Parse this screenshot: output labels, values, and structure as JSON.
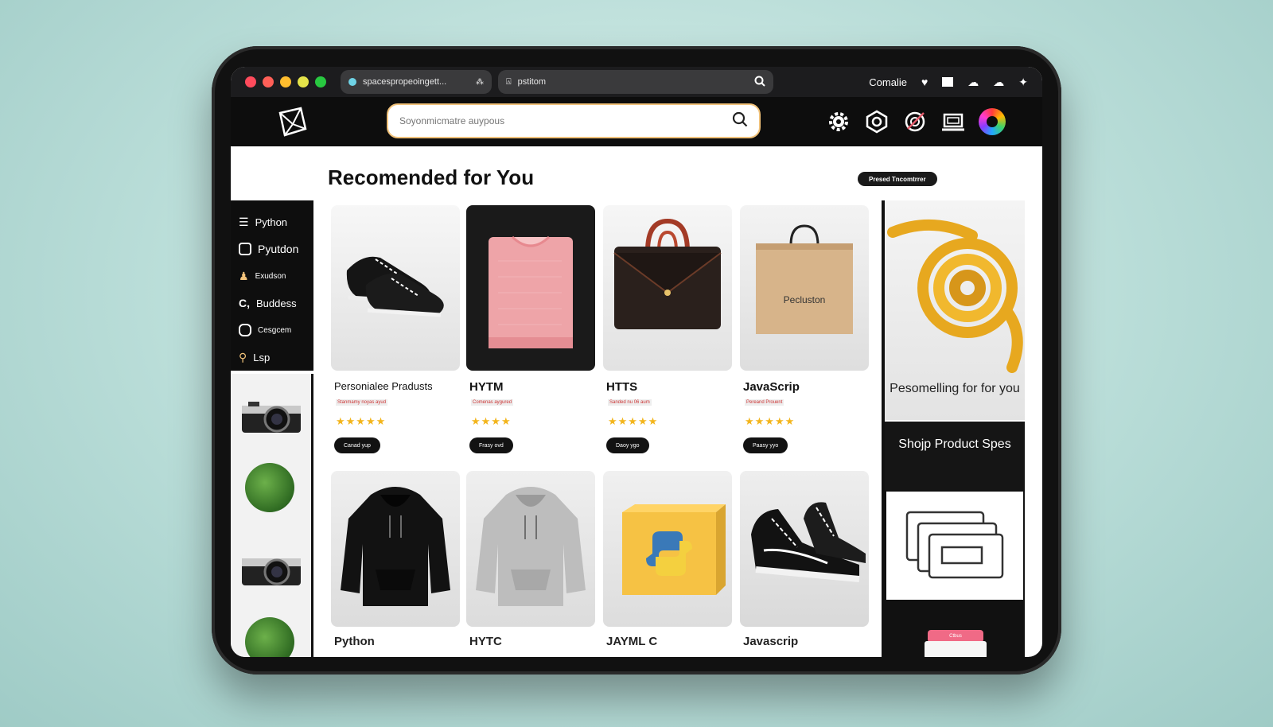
{
  "browser": {
    "tab1_label": "spacespropeoingett...",
    "tab2_label": "pstitom",
    "right_label": "Comalie"
  },
  "header": {
    "search_placeholder": "Soyonmicmatre auypous"
  },
  "main": {
    "title": "Recomended for You",
    "pill_label": "Presed Tncomtrrer"
  },
  "sidebar": {
    "items": [
      {
        "label": "Python",
        "icon": "wifi-icon"
      },
      {
        "label": "Pyutdon",
        "icon": "square-icon"
      },
      {
        "label": "Exudson",
        "icon": "person-icon"
      },
      {
        "label": "Buddess",
        "icon": "c-icon",
        "prefix": "C,"
      },
      {
        "label": "Cesgcem",
        "icon": "chat-icon"
      },
      {
        "label": "Lsp",
        "icon": "location-icon"
      }
    ]
  },
  "products_row1": [
    {
      "name": "Personialee Pradusts",
      "sub": "Stanmamy noyas ayud",
      "stars": "★★★★★",
      "btn": "Canad yup"
    },
    {
      "name": "HYTM",
      "sub": "Comenas aygured",
      "stars": "★★★★",
      "btn": "Frasy ovd"
    },
    {
      "name": "HTTS",
      "sub": "Sanded nu 06 aum",
      "stars": "★★★★★",
      "btn": "Daoy ygo"
    },
    {
      "name": "JavaScrip",
      "sub": "Pereand Prouent",
      "stars": "★★★★★",
      "btn": "Paasy yyo"
    }
  ],
  "products_row2": [
    {
      "name": "Python"
    },
    {
      "name": "HYTC"
    },
    {
      "name": "JAYML C"
    },
    {
      "name": "Javascrip"
    }
  ],
  "bag_label": "Pecluston",
  "promo": {
    "title": "Pesomelling for for you",
    "dark_text": "Shojp Product Spes",
    "mini_btn": "Ctbus"
  },
  "colors": {
    "accent": "#f3b51c",
    "dark": "#111111",
    "traffic": [
      "#ff4b5c",
      "#ff5f57",
      "#ffbd2e",
      "#e4e34a",
      "#28c840"
    ]
  }
}
